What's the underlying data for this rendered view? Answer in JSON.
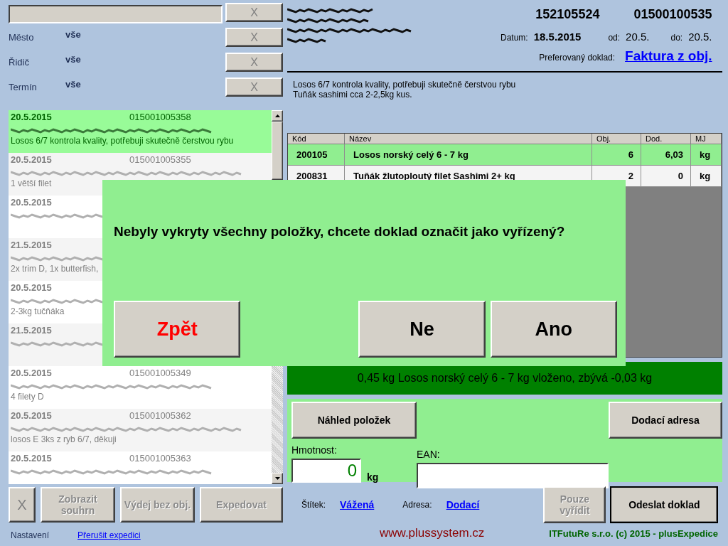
{
  "filters": {
    "search_clear": "X",
    "items": [
      {
        "label": "Město",
        "value": "vše",
        "clear": "X"
      },
      {
        "label": "Řidič",
        "value": "vše",
        "clear": "X"
      },
      {
        "label": "Termín",
        "value": "vše",
        "clear": "X"
      }
    ]
  },
  "orders": [
    {
      "date": "20.5.2015",
      "number": "015001005358",
      "note": "Losos 6/7 kontrola kvality, potřebuji skutečně čerstvou rybu",
      "selected": true
    },
    {
      "date": "20.5.2015",
      "number": "015001005355",
      "note": "1 větší filet",
      "selected": false
    },
    {
      "date": "20.5.2015",
      "selected": false
    },
    {
      "date": "21.5.2015",
      "note": "2x trim D, 1x butterfish,",
      "selected": false
    },
    {
      "date": "20.5.2015",
      "note": "2-3kg tučňáka",
      "selected": false
    },
    {
      "date": "21.5.2015",
      "selected": false
    },
    {
      "date": "20.5.2015",
      "number": "015001005349",
      "note": "4 filety D",
      "selected": false
    },
    {
      "date": "20.5.2015",
      "number": "015001005362",
      "note": "losos E 3ks z ryb 6/7, děkuji",
      "selected": false
    },
    {
      "date": "20.5.2015",
      "number": "015001005363",
      "selected": false
    }
  ],
  "list_buttons": [
    {
      "label": "X",
      "disabled": false
    },
    {
      "label": "Zobrazit souhrn",
      "disabled": true
    },
    {
      "label": "Výdej bez obj.",
      "disabled": true
    },
    {
      "label": "Expedovat",
      "disabled": true
    }
  ],
  "left_footer": {
    "settings": "Nastavení",
    "link": "Přerušit expedici"
  },
  "header": {
    "order_number": "152105524",
    "document_number": "01500100535",
    "date_label": "Datum:",
    "date": "18.5.2015",
    "from_label": "od:",
    "from": "20.5.",
    "to_label": "do:",
    "to": "20.5.",
    "preferred_label": "Preferovaný doklad:",
    "preferred": "Faktura z obj."
  },
  "order_note": [
    "Losos 6/7 kontrola kvality, potřebuji skutečně čerstvou rybu",
    "Tuňák sashimi cca 2-2,5kg kus."
  ],
  "table": {
    "columns": [
      "Kód",
      "Název",
      "Obj.",
      "Dod.",
      "MJ"
    ],
    "rows": [
      {
        "cells": [
          "200105",
          "Losos norský celý 6 - 7 kg",
          "6",
          "6,03",
          "kg"
        ],
        "selected": true
      },
      {
        "cells": [
          "200831",
          "Tuňák žlutoploutý filet Sashimi 2+ kg",
          "2",
          "0",
          "kg"
        ],
        "selected": false
      }
    ]
  },
  "status": "0,45 kg Losos norský celý 6 - 7 kg vloženo, zbývá -0,03 kg",
  "panel": {
    "preview_button": "Náhled položek",
    "address_button": "Dodací adresa",
    "weight_label": "Hmotnost:",
    "weight_value": "0",
    "weight_unit": "kg",
    "ean_label": "EAN:"
  },
  "bottom": {
    "label_caption": "Štítek:",
    "label_link": "Vážená",
    "address_caption": "Adresa:",
    "address_link": "Dodací",
    "buttons": [
      {
        "label": "Pouze vyřídit",
        "disabled": true
      },
      {
        "label": "Odeslat doklad",
        "disabled": false
      }
    ]
  },
  "footer": {
    "website": "www.plussystem.cz",
    "copyright": "ITFutuRe s.r.o. (c) 2015 - plusExpedice"
  },
  "dialog": {
    "message": "Nebyly vykryty všechny položky, chcete doklad označit jako vyřízený?",
    "buttons": [
      {
        "label": "Zpět",
        "kind": "back"
      },
      {
        "label": "Ne",
        "kind": "normal"
      },
      {
        "label": "Ano",
        "kind": "normal"
      }
    ]
  }
}
